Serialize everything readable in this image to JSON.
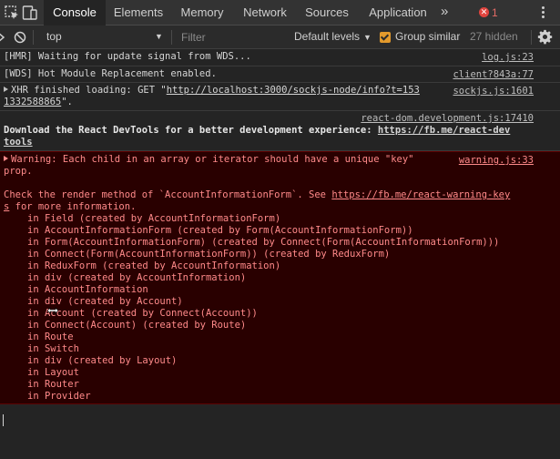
{
  "tabs": [
    {
      "label": "Console",
      "active": true
    },
    {
      "label": "Elements"
    },
    {
      "label": "Memory"
    },
    {
      "label": "Network"
    },
    {
      "label": "Sources"
    },
    {
      "label": "Application"
    }
  ],
  "more_tabs": "»",
  "error_badge": {
    "symbol": "✕",
    "count": "1"
  },
  "toolbar": {
    "context": "top",
    "filter_placeholder": "Filter",
    "levels": "Default levels",
    "group_similar": "Group similar",
    "hidden": "27 hidden"
  },
  "messages": {
    "hmr": {
      "text": "[HMR] Waiting for update signal from WDS...",
      "source": "log.js:23"
    },
    "wds": {
      "text": "[WDS] Hot Module Replacement enabled.",
      "source": "client?843a:77"
    },
    "xhr": {
      "line1_prefix": "XHR finished loading: GET \"",
      "url1": "http://localhost:3000/sockjs-node/info?t=153",
      "url2": "1332588865",
      "suffix": "\".",
      "source": "sockjs.js:1601"
    },
    "devtools": {
      "source": "react-dom.development.js:17410",
      "text": "Download the React DevTools for a better development experience: ",
      "url1": "https://fb.me/react-dev",
      "url2": "tools"
    },
    "warning": {
      "line1": "Warning: Each child in an array or iterator should have a unique \"key\"",
      "line2": "prop.",
      "source": "warning.js:33",
      "check1": "Check the render method of `AccountInformationForm`. See ",
      "check_url1": "https://fb.me/react-warning-key",
      "check_url2": "s",
      "check2": " for more information.",
      "stack": [
        "in Field (created by AccountInformationForm)",
        "in AccountInformationForm (created by Form(AccountInformationForm))",
        "in Form(AccountInformationForm) (created by Connect(Form(AccountInformationForm)))",
        "in Connect(Form(AccountInformationForm)) (created by ReduxForm)",
        "in ReduxForm (created by AccountInformation)",
        "in div (created by AccountInformation)",
        "in AccountInformation",
        "in div (created by Account)",
        "in Account (created by Connect(Account))",
        "in Connect(Account) (created by Route)",
        "in Route",
        "in Switch",
        "in div (created by Layout)",
        "in Layout",
        "in Router",
        "in Provider"
      ]
    }
  },
  "colors": {
    "warning_bg": "#290000",
    "warning_text": "#ff8a8a",
    "checkbox": "#e39a2c",
    "error": "#e0443e"
  }
}
